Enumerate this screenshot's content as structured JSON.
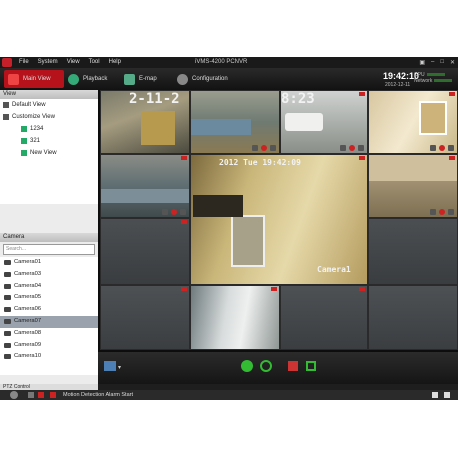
{
  "window": {
    "title": "iVMS-4200 PCNVR"
  },
  "menu": [
    "File",
    "System",
    "View",
    "Tool",
    "Help"
  ],
  "tabs": [
    {
      "label": "Main View",
      "active": true
    },
    {
      "label": "Playback",
      "active": false
    },
    {
      "label": "E-map",
      "active": false
    },
    {
      "label": "Configuration",
      "active": false
    }
  ],
  "clock": {
    "time": "19:42:10",
    "date": "2012-12-11",
    "cpu_label": "CPU",
    "network_label": "Network"
  },
  "view_panel": {
    "header": "View",
    "items": [
      {
        "label": "Default View",
        "level": 0
      },
      {
        "label": "Customize View",
        "level": 0
      },
      {
        "label": "1234",
        "level": 1
      },
      {
        "label": "321",
        "level": 1
      },
      {
        "label": "New View",
        "level": 1
      }
    ]
  },
  "camera_panel": {
    "header": "Camera",
    "search_placeholder": "Search...",
    "cameras": [
      "Camera01",
      "Camera03",
      "Camera04",
      "Camera05",
      "Camera06",
      "Camera07",
      "Camera08",
      "Camera09",
      "Camera10"
    ],
    "selected": "Camera07"
  },
  "ptz_panel": {
    "header": "PTZ Control"
  },
  "video": {
    "tile1_time": "2-11-2",
    "tile3_time": "8:23",
    "main_timestamp": "2012 Tue 19:42:09",
    "main_label": "Camera1"
  },
  "status": {
    "message": "Motion Detection Alarm Start"
  },
  "colors": {
    "accent": "#b5121b",
    "background": "#1e1e1e",
    "panel": "#ececec",
    "selected_row": "#9aa3ad"
  }
}
